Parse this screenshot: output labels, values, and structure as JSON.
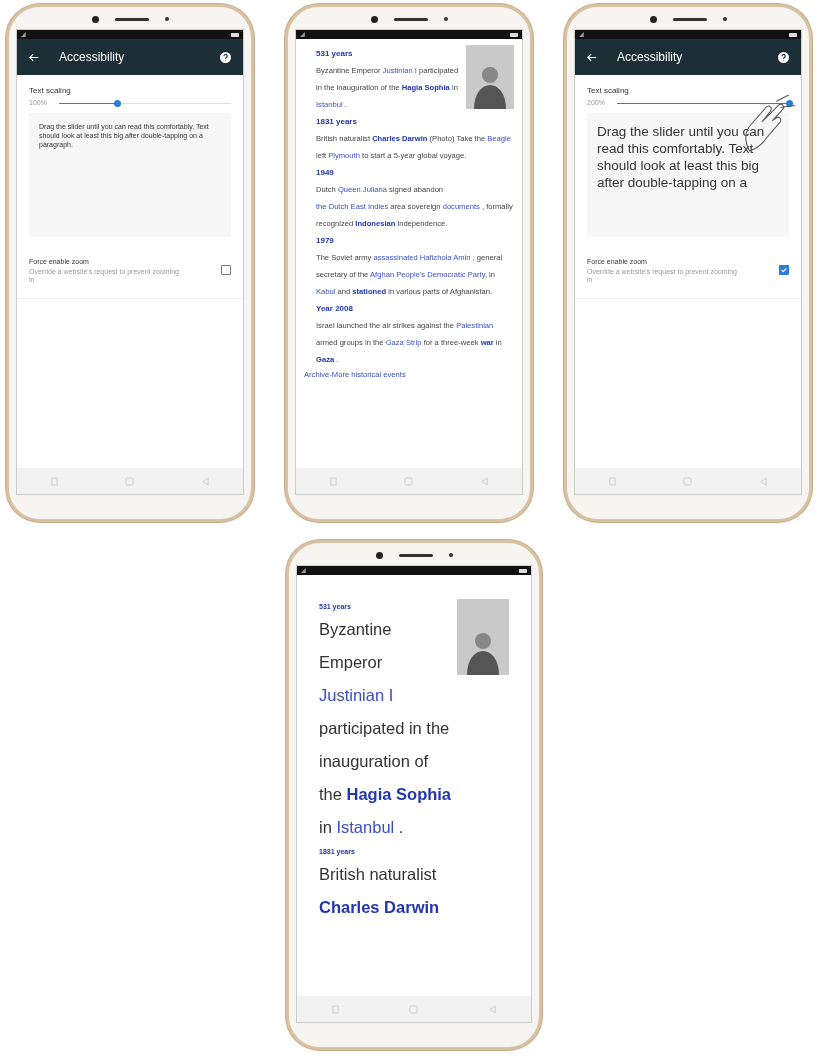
{
  "phones": [
    {
      "kind": "settings",
      "toolbar": {
        "title": "Accessibility"
      },
      "text_scaling": {
        "label": "Text scaling",
        "reading": "100%",
        "level": 0.34
      },
      "preview": {
        "text": "Drag the slider until you can read this comfortably. Text should look at least this big after double-tapping on a paragraph."
      },
      "gesture_hint": false,
      "force_zoom": {
        "title": "Force enable zoom",
        "description": "Override a website's request to prevent zooming in",
        "checked": false
      }
    },
    {
      "kind": "article",
      "entries": [
        {
          "kind": "heading",
          "text": "531 years"
        },
        {
          "kind": "paragraph",
          "segments": [
            {
              "kind": "text",
              "text": "Byzantine Emperor "
            },
            {
              "kind": "link",
              "text": "Justinian I"
            },
            {
              "kind": "text",
              "text": " participated in the inauguration of the "
            },
            {
              "kind": "bold_link",
              "text": "Hagia Sophia"
            },
            {
              "kind": "text",
              "text": " in "
            },
            {
              "kind": "link",
              "text": "Istanbul"
            },
            {
              "kind": "text",
              "text": " ."
            }
          ]
        },
        {
          "kind": "heading",
          "text": "1831 years"
        },
        {
          "kind": "paragraph",
          "segments": [
            {
              "kind": "text",
              "text": "British naturalist "
            },
            {
              "kind": "bold_link",
              "text": "Charles Darwin"
            },
            {
              "kind": "text",
              "text": " (Photo) Take the "
            },
            {
              "kind": "link",
              "text": "Beagle"
            },
            {
              "kind": "text",
              "text": " left "
            },
            {
              "kind": "link",
              "text": "Plymouth"
            },
            {
              "kind": "text",
              "text": " to start a 5-year global voyage."
            }
          ]
        },
        {
          "kind": "heading",
          "text": "1949"
        },
        {
          "kind": "paragraph",
          "segments": [
            {
              "kind": "text",
              "text": "Dutch "
            },
            {
              "kind": "link",
              "text": "Queen Juliana"
            },
            {
              "kind": "text",
              "text": " signed abandon "
            },
            {
              "kind": "link",
              "text": "the Dutch East Indies"
            },
            {
              "kind": "text",
              "text": " area sovereign "
            },
            {
              "kind": "link",
              "text": "documents"
            },
            {
              "kind": "text",
              "text": " , formally recognized "
            },
            {
              "kind": "bold_link",
              "text": "Indonesian"
            },
            {
              "kind": "text",
              "text": " independence."
            }
          ]
        },
        {
          "kind": "heading",
          "text": "1979"
        },
        {
          "kind": "paragraph",
          "segments": [
            {
              "kind": "text",
              "text": "The Soviet army "
            },
            {
              "kind": "link",
              "text": "assassinated"
            },
            {
              "kind": "link",
              "text": "Hafizhola Amin"
            },
            {
              "kind": "text",
              "text": " , general secretary of the "
            },
            {
              "kind": "link",
              "text": "Afghan People's Democratic Party"
            },
            {
              "kind": "text",
              "text": ", in "
            },
            {
              "kind": "link",
              "text": "Kabul"
            },
            {
              "kind": "text",
              "text": " and "
            },
            {
              "kind": "bold_link",
              "text": "stationed"
            },
            {
              "kind": "text",
              "text": " in various parts of Afghanistan."
            }
          ]
        },
        {
          "kind": "heading",
          "text": "Year 2008"
        },
        {
          "kind": "paragraph",
          "segments": [
            {
              "kind": "text",
              "text": "Israel launched the air strikes against the "
            },
            {
              "kind": "link",
              "text": "Palestinian"
            },
            {
              "kind": "text",
              "text": " armed groups in the "
            },
            {
              "kind": "link",
              "text": "Gaza Strip"
            },
            {
              "kind": "text",
              "text": " for a three-week "
            },
            {
              "kind": "bold_link",
              "text": "war"
            },
            {
              "kind": "text",
              "text": " in "
            },
            {
              "kind": "bold_link",
              "text": "Gaza"
            },
            {
              "kind": "text",
              "text": " ."
            }
          ]
        }
      ],
      "footer": [
        {
          "kind": "link",
          "text": "Archive"
        },
        {
          "kind": "text",
          "text": " - "
        },
        {
          "kind": "link",
          "text": "More historical events"
        }
      ]
    },
    {
      "kind": "settings",
      "toolbar": {
        "title": "Accessibility"
      },
      "text_scaling": {
        "label": "Text scaling",
        "reading": "200%",
        "level": 1
      },
      "preview": {
        "text": "Drag the slider until you can read this comfortably. Text should look at least this big after double-tapping on a"
      },
      "gesture_hint": true,
      "force_zoom": {
        "title": "Force enable zoom",
        "description": "Override a website's request to prevent zooming in",
        "checked": true
      }
    },
    {
      "kind": "enlarged",
      "entries": [
        {
          "kind": "heading",
          "text": "531 years"
        },
        {
          "kind": "paragraph",
          "segments": [
            {
              "kind": "text",
              "text": "Byzantine Emperor "
            },
            {
              "kind": "link",
              "text": "Justinian I"
            },
            {
              "kind": "text",
              "text": " participated in the inauguration of the "
            },
            {
              "kind": "bold_link",
              "text": "Hagia Sophia"
            },
            {
              "kind": "text",
              "text": " in "
            },
            {
              "kind": "link",
              "text": "Istanbul"
            },
            {
              "kind": "text",
              "text": " ."
            }
          ]
        },
        {
          "kind": "heading",
          "text": "1831 years"
        },
        {
          "kind": "paragraph",
          "segments": [
            {
              "kind": "text",
              "text": "British naturalist "
            },
            {
              "kind": "bold_link",
              "text": "Charles Darwin"
            }
          ]
        }
      ]
    }
  ]
}
